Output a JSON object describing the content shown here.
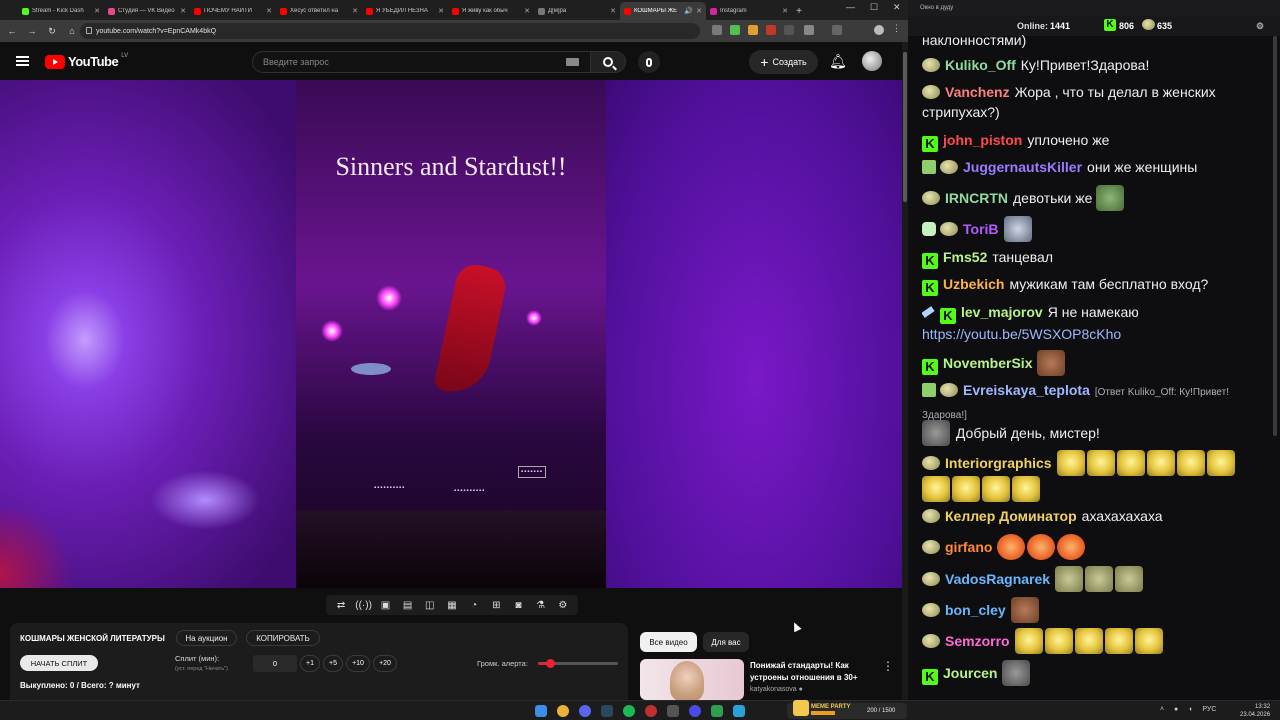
{
  "browser": {
    "tabs": [
      {
        "title": "Stream - Kick Dash",
        "color": "#53fc18"
      },
      {
        "title": "Студия — VK Видео",
        "color": "#e64a8c"
      },
      {
        "title": "ПОЧЕМУ НАЙТИ",
        "color": "#ff0000"
      },
      {
        "title": "Хесус ответил на",
        "color": "#ff0000"
      },
      {
        "title": "Я УБЕДИЛ НЕЗНА",
        "color": "#ff0000"
      },
      {
        "title": "Я живу как обыч",
        "color": "#ff0000"
      },
      {
        "title": "Д[м]ра",
        "color": "#777777"
      },
      {
        "title": "КОШМАРЫ ЖЕ",
        "color": "#ff0000"
      },
      {
        "title": "Instagram",
        "color": "#d6249f"
      }
    ],
    "url": "youtube.com/watch?v=EpnCAMk4bkQ"
  },
  "youtube": {
    "logo_text": "YouTube",
    "country": "LV",
    "search_placeholder": "Введите запрос",
    "create_label": "Создать",
    "video_overlay_text": "Sinners and Stardust!!"
  },
  "auction_panel": {
    "title": "КОШМАРЫ ЖЕНСКОЙ ЛИТЕРАТУРЫ",
    "auction_btn": "На аукцион",
    "copy_btn": "КОПИРОВАТЬ",
    "start_btn": "НАЧАТЬ СПЛИТ",
    "split_label": "Сплит (мин):",
    "split_hint": "(уст. перед \"Начать\")",
    "split_value": "0",
    "increments": [
      "+1",
      "+5",
      "+10",
      "+20"
    ],
    "volume_label": "Громк. алерта:",
    "volume_level": 0.15,
    "bought_text": "Выкуплено: 0 / Всего: ? минут"
  },
  "recommendations": {
    "chip_all": "Все видео",
    "chip_for_you": "Для вас",
    "title": "Понижай стандарты! Как устроены отношения в 30+",
    "channel": "katyakonasova"
  },
  "chat": {
    "window_title": "Окно в дуду",
    "online_label": "Online:",
    "online_value": "1441",
    "kick_count": "806",
    "other_count": "635",
    "messages": [
      {
        "nick": "",
        "text": "наклонностями)",
        "color": "#efeff1"
      },
      {
        "nick": "Kuliko_Off",
        "text": "Ку!Привет!Здарова!",
        "color": "#8fdca0"
      },
      {
        "nick": "Vanchenz",
        "text": "Жора , что ты делал в женских стрипухах?)",
        "color": "#ff7f7f"
      },
      {
        "nick": "john_piston",
        "text": "уплочено же",
        "color": "#ff4b4b"
      },
      {
        "nick": "JuggernautsKiller",
        "text": "они же женщины",
        "color": "#9b7bff"
      },
      {
        "nick": "IRNCRTN",
        "text": "девотьки же",
        "color": "#8fdca0"
      },
      {
        "nick": "ToriB",
        "text": "",
        "color": "#b05cff"
      },
      {
        "nick": "Fms52",
        "text": "танцевал",
        "color": "#b8f28a"
      },
      {
        "nick": "Uzbekich",
        "text": "мужикам там бесплатно вход?",
        "color": "#ffb347"
      },
      {
        "nick": "lev_majorov",
        "text": "Я не намекаю",
        "color": "#b8f28a"
      },
      {
        "nick": "",
        "text": "https://youtu.be/5WSXOP8cKho",
        "color": "#a0b7ff"
      },
      {
        "nick": "NovemberSix",
        "text": "",
        "color": "#b8f28a"
      },
      {
        "nick": "Evreiskaya_teplota",
        "text": "[Ответ Kuliko_Off: Ку!Привет! Здарова!]",
        "color": "#a0b7ff"
      },
      {
        "nick": "",
        "text": "Добрый день, мистер!",
        "color": "#efeff1"
      },
      {
        "nick": "Interiorgraphics",
        "text": "",
        "color": "#f0d264"
      },
      {
        "nick": "Келлер Доминатор",
        "text": "ахахахахаха",
        "color": "#f0d264"
      },
      {
        "nick": "girfano",
        "text": "",
        "color": "#ff8a3d"
      },
      {
        "nick": "VadosRagnarek",
        "text": "",
        "color": "#6ab7ff"
      },
      {
        "nick": "bon_cley",
        "text": "",
        "color": "#6ab7ff"
      },
      {
        "nick": "Semzorro",
        "text": "",
        "color": "#ff6ad5"
      },
      {
        "nick": "Jourcen",
        "text": "",
        "color": "#b8f28a"
      }
    ]
  },
  "taskbar": {
    "meme_label": "MEME PARTY",
    "meme_progress": "200 / 1500",
    "lang": "РУС",
    "time": "13:32",
    "date": "23.04.2026"
  }
}
